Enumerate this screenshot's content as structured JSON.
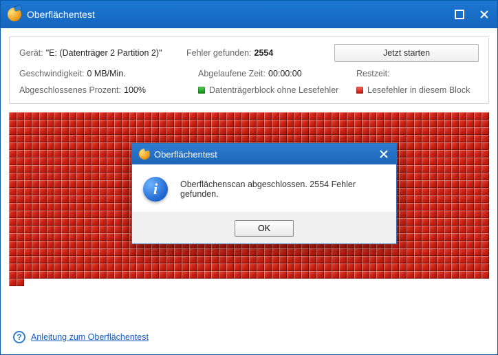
{
  "window": {
    "title": "Oberflächentest"
  },
  "info": {
    "device_label": "Gerät:",
    "device_value": "\"E: (Datenträger 2 Partition 2)\"",
    "errors_label": "Fehler gefunden:",
    "errors_value": "2554",
    "start_button": "Jetzt starten",
    "speed_label": "Geschwindigkeit:",
    "speed_value": "0 MB/Min.",
    "elapsed_label": "Abgelaufene Zeit:",
    "elapsed_value": "00:00:00",
    "remaining_label": "Restzeit:",
    "remaining_value": "",
    "percent_label": "Abgeschlossenes Prozent:",
    "percent_value": "100%",
    "legend_ok": "Datenträgerblock ohne Lesefehler",
    "legend_err": "Lesefehler in diesem Block"
  },
  "grid": {
    "rows": 23,
    "cols": 64,
    "last_row_filled": 2,
    "block_status": "error"
  },
  "dialog": {
    "title": "Oberflächentest",
    "message": "Oberflächenscan abgeschlossen. 2554 Fehler gefunden.",
    "ok": "OK"
  },
  "footer": {
    "help_link": "Anleitung zum Oberflächentest"
  },
  "colors": {
    "accent": "#1b6dc1",
    "error_block": "#c71f12",
    "ok_block": "#1a9a1a"
  }
}
